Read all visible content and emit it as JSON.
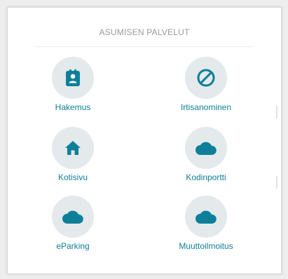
{
  "panel": {
    "title": "ASUMISEN PALVELUT"
  },
  "services": [
    {
      "label": "Hakemus",
      "icon": "contact-card-icon"
    },
    {
      "label": "Irtisanominen",
      "icon": "prohibited-icon"
    },
    {
      "label": "Kotisivu",
      "icon": "home-icon"
    },
    {
      "label": "Kodinportti",
      "icon": "cloud-icon"
    },
    {
      "label": "eParking",
      "icon": "cloud-icon"
    },
    {
      "label": "Muuttoilmoitus",
      "icon": "cloud-icon"
    }
  ],
  "colors": {
    "accent": "#0e7f99",
    "icon_background": "#e4e9ec",
    "title_text": "#9a9a9a"
  }
}
